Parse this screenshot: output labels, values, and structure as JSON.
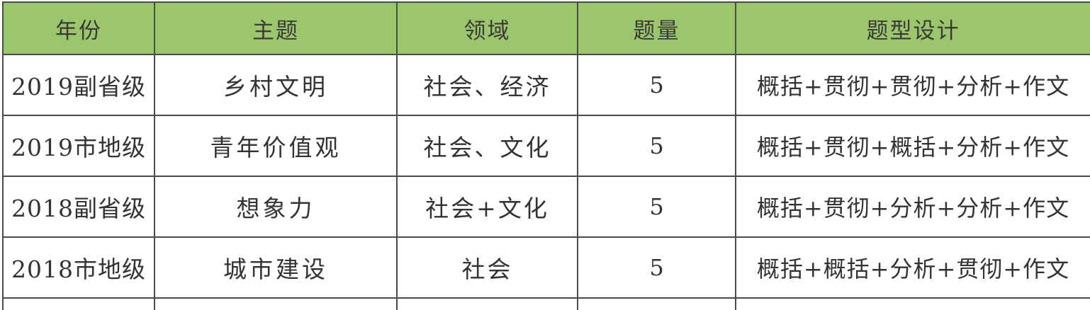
{
  "table": {
    "headers": [
      "年份",
      "主题",
      "领域",
      "题量",
      "题型设计"
    ],
    "rows": [
      {
        "year": "2019副省级",
        "topic": "乡村文明",
        "field": "社会、经济",
        "count": "5",
        "design": "概括+贯彻+贯彻+分析+作文"
      },
      {
        "year": "2019市地级",
        "topic": "青年价值观",
        "field": "社会、文化",
        "count": "5",
        "design": "概括+贯彻+概括+分析+作文"
      },
      {
        "year": "2018副省级",
        "topic": "想象力",
        "field": "社会+文化",
        "count": "5",
        "design": "概括+贯彻+分析+分析+作文"
      },
      {
        "year": "2018市地级",
        "topic": "城市建设",
        "field": "社会",
        "count": "5",
        "design": "概括+概括+分析+贯彻+作文"
      }
    ]
  },
  "colors": {
    "header_background": "#9bc66b",
    "border": "#4a4a4a",
    "text": "#333333"
  }
}
